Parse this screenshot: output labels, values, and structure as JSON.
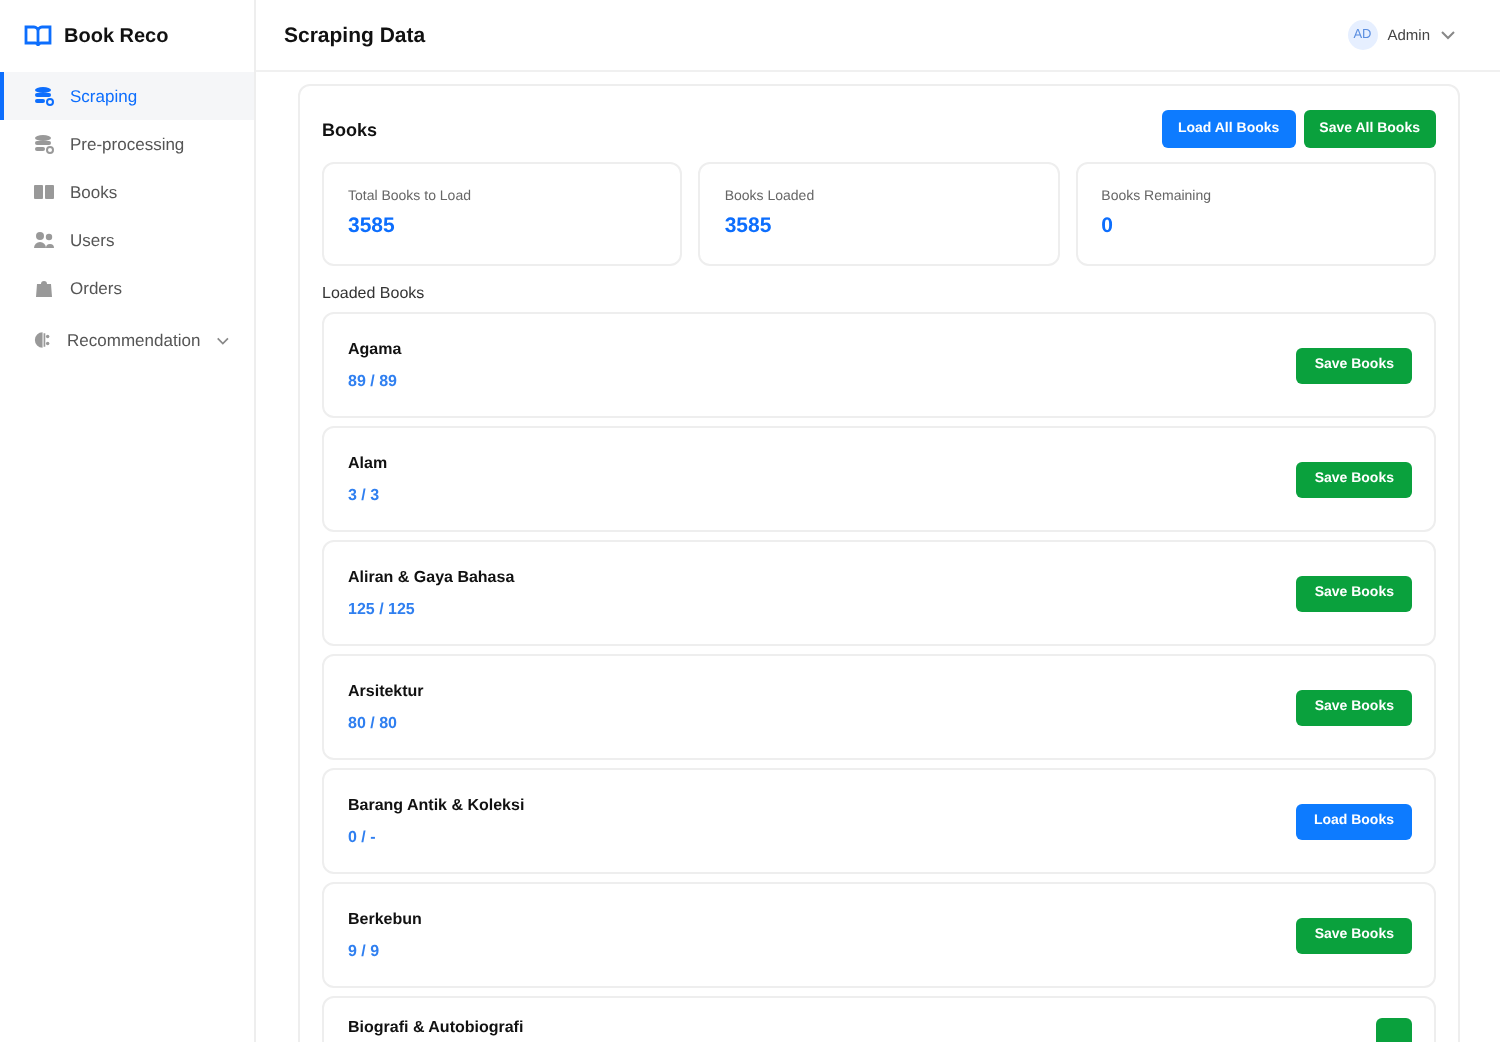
{
  "brand": {
    "name": "Book Reco"
  },
  "sidebar": {
    "items": [
      {
        "label": "Scraping",
        "selected": true,
        "expandable": false
      },
      {
        "label": "Pre-processing",
        "selected": false,
        "expandable": false
      },
      {
        "label": "Books",
        "selected": false,
        "expandable": false
      },
      {
        "label": "Users",
        "selected": false,
        "expandable": false
      },
      {
        "label": "Orders",
        "selected": false,
        "expandable": false
      },
      {
        "label": "Recommendation",
        "selected": false,
        "expandable": true
      }
    ]
  },
  "header": {
    "title": "Scraping Data",
    "user": {
      "initials": "AD",
      "name": "Admin"
    }
  },
  "panel": {
    "title": "Books",
    "actions": [
      {
        "label": "Load All Books",
        "kind": "load"
      },
      {
        "label": "Save All Books",
        "kind": "save"
      }
    ],
    "stats": [
      {
        "label": "Total Books to Load",
        "value": "3585"
      },
      {
        "label": "Books Loaded",
        "value": "3585"
      },
      {
        "label": "Books Remaining",
        "value": "0"
      }
    ],
    "list_title": "Loaded Books",
    "categories": [
      {
        "name": "Agama",
        "count": "89 / 89",
        "action": {
          "label": "Save Books",
          "kind": "save"
        }
      },
      {
        "name": "Alam",
        "count": "3 / 3",
        "action": {
          "label": "Save Books",
          "kind": "save"
        }
      },
      {
        "name": "Aliran & Gaya Bahasa",
        "count": "125 / 125",
        "action": {
          "label": "Save Books",
          "kind": "save"
        }
      },
      {
        "name": "Arsitektur",
        "count": "80 / 80",
        "action": {
          "label": "Save Books",
          "kind": "save"
        }
      },
      {
        "name": "Barang Antik & Koleksi",
        "count": "0 / -",
        "action": {
          "label": "Load Books",
          "kind": "load"
        }
      },
      {
        "name": "Berkebun",
        "count": "9 / 9",
        "action": {
          "label": "Save Books",
          "kind": "save"
        }
      },
      {
        "name": "Biografi & Autobiografi",
        "action": {
          "kind": "save"
        }
      }
    ]
  }
}
